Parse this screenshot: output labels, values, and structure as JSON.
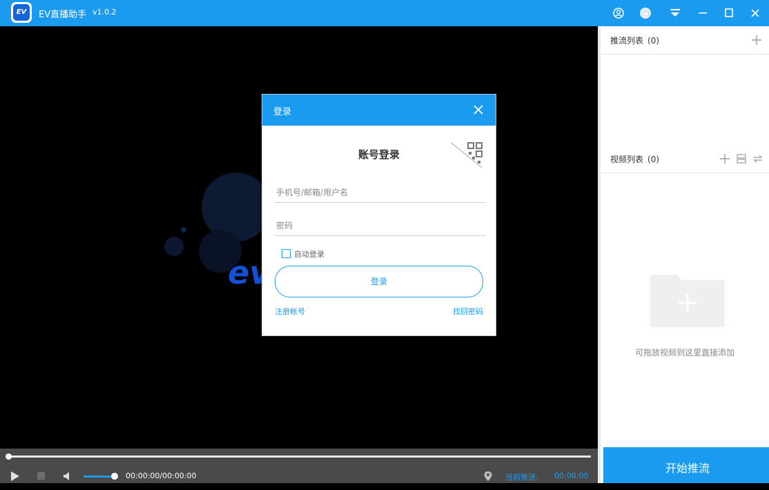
{
  "app": {
    "title": "EV直播助手",
    "version": "v1.0.2",
    "logo_text": "EV"
  },
  "titlebar": {
    "icons": [
      "user-circle-icon",
      "crown-icon",
      "dropdown-menu-icon",
      "minimize-icon",
      "maximize-icon",
      "close-icon"
    ]
  },
  "splash": {
    "brand_text": "ev"
  },
  "player": {
    "time": "00:00:00/00:00:00",
    "current_push_label": "当前推送:",
    "current_push_value": "00:00:00",
    "progress": 0,
    "volume": 1
  },
  "sidebar": {
    "push_list": {
      "title": "推流列表",
      "count": "(0)"
    },
    "video_list": {
      "title": "视频列表",
      "count": "(0)"
    },
    "empty_hint": "可拖放视频到这里直接添加",
    "start_button": "开始推流"
  },
  "login_dialog": {
    "title": "登录",
    "heading": "账号登录",
    "username_placeholder": "手机号/邮箱/用户名",
    "password_placeholder": "密码",
    "auto_login_label": "自动登录",
    "auto_login_checked": false,
    "login_button": "登录",
    "register_link": "注册帐号",
    "forgot_link": "找回密码"
  },
  "colors": {
    "accent": "#1a9bf0",
    "video_bg": "#000000",
    "controls_bg": "#4a4a4a"
  }
}
